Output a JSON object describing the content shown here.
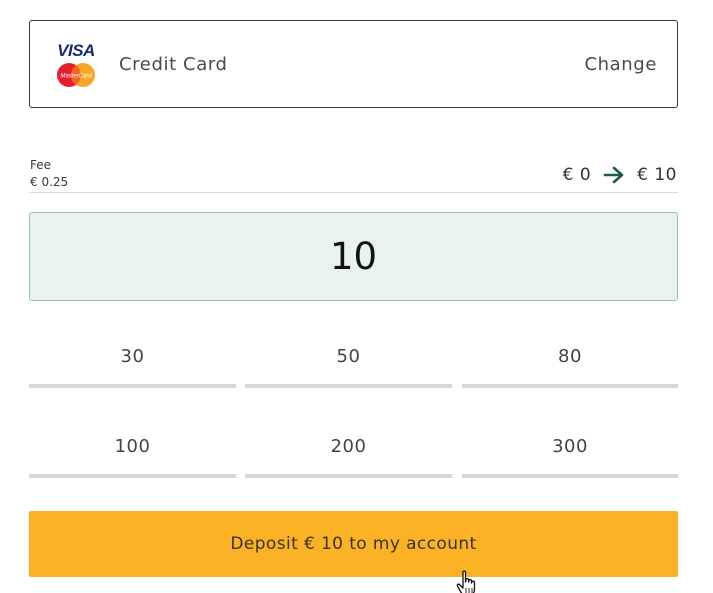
{
  "payment_method": {
    "brand_visa": "VISA",
    "brand_mastercard": "MasterCard",
    "label": "Credit Card",
    "change_label": "Change"
  },
  "fee": {
    "title": "Fee",
    "value": "€ 0.25"
  },
  "conversion": {
    "from": "€ 0",
    "to": "€ 10",
    "icon": "arrow-right-icon"
  },
  "amount": {
    "value": "10"
  },
  "presets": [
    "30",
    "50",
    "80",
    "100",
    "200",
    "300"
  ],
  "deposit_button": {
    "label": "Deposit € 10 to my account"
  },
  "colors": {
    "accent": "#fbb325",
    "amount_bg": "#e7f3ec",
    "arrow": "#1f5a44"
  }
}
